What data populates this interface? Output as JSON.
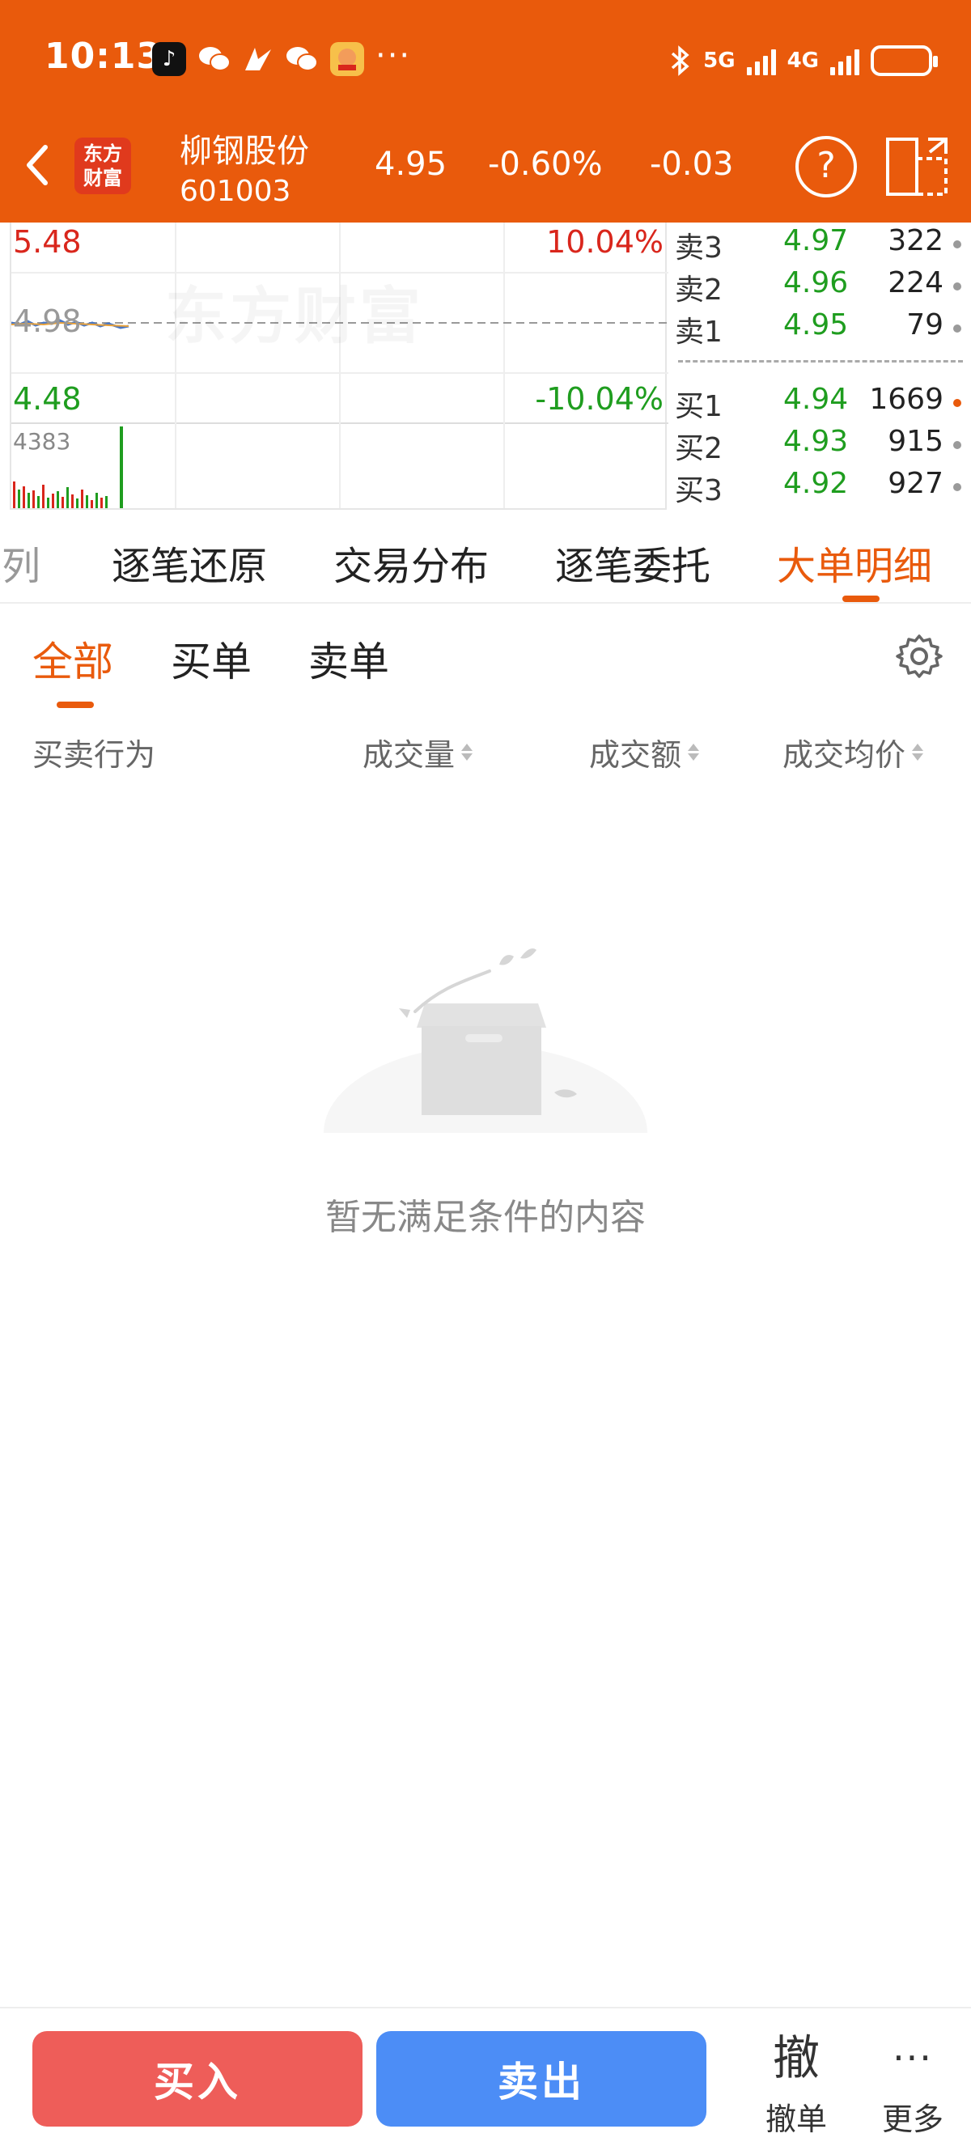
{
  "status_bar": {
    "time": "10:13",
    "more": "···",
    "net_5g": "5G",
    "net_4g": "4G"
  },
  "nav": {
    "logo_line1": "东方",
    "logo_line2": "财富",
    "stock_name": "柳钢股份",
    "stock_code": "601003",
    "price": "4.95",
    "change_pct": "-0.60%",
    "change": "-0.03",
    "help_glyph": "?"
  },
  "chart": {
    "watermark": "东方财富",
    "high_price": "5.48",
    "high_pct": "10.04%",
    "mid_price": "4.98",
    "low_price": "4.48",
    "low_pct": "-10.04%",
    "volume_max": "4383"
  },
  "orderbook": {
    "asks": [
      {
        "label": "卖3",
        "price": "4.97",
        "volume": "322"
      },
      {
        "label": "卖2",
        "price": "4.96",
        "volume": "224"
      },
      {
        "label": "卖1",
        "price": "4.95",
        "volume": "79"
      }
    ],
    "bids": [
      {
        "label": "买1",
        "price": "4.94",
        "volume": "1669"
      },
      {
        "label": "买2",
        "price": "4.93",
        "volume": "915"
      },
      {
        "label": "买3",
        "price": "4.92",
        "volume": "927"
      }
    ]
  },
  "tabs": {
    "items": [
      "入列",
      "逐笔还原",
      "交易分布",
      "逐笔委托",
      "大单明细"
    ],
    "active": "大单明细"
  },
  "subtabs": {
    "items": [
      "全部",
      "买单",
      "卖单"
    ],
    "active": "全部"
  },
  "columns": [
    "买卖行为",
    "成交量",
    "成交额",
    "成交均价"
  ],
  "empty_message": "暂无满足条件的内容",
  "bottom_bar": {
    "buy": "买入",
    "sell": "卖出",
    "cancel_icon": "撤",
    "cancel_label": "撤单",
    "more_icon": "···",
    "more_label": "更多"
  },
  "colors": {
    "brand": "#E95A0C",
    "up": "#D9261C",
    "down": "#1F9D1F",
    "buy_button": "#EE5D59",
    "sell_button": "#4C8DF6"
  }
}
